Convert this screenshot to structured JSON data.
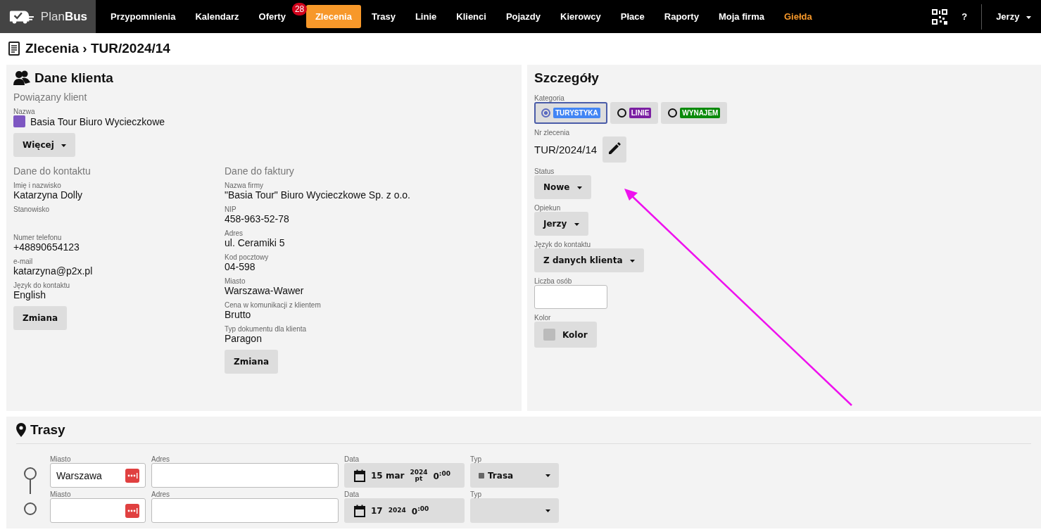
{
  "app": {
    "logo_light": "Plan",
    "logo_bold": "Bus"
  },
  "nav": [
    {
      "label": "Przypomnienia",
      "selected": false,
      "highlighted": false
    },
    {
      "label": "Kalendarz",
      "selected": false,
      "highlighted": false
    },
    {
      "label": "Oferty",
      "selected": false,
      "highlighted": false,
      "badge": "28"
    },
    {
      "label": "Zlecenia",
      "selected": true,
      "highlighted": false
    },
    {
      "label": "Trasy",
      "selected": false,
      "highlighted": false
    },
    {
      "label": "Linie",
      "selected": false,
      "highlighted": false
    },
    {
      "label": "Klienci",
      "selected": false,
      "highlighted": false
    },
    {
      "label": "Pojazdy",
      "selected": false,
      "highlighted": false
    },
    {
      "label": "Kierowcy",
      "selected": false,
      "highlighted": false
    },
    {
      "label": "Płace",
      "selected": false,
      "highlighted": false
    },
    {
      "label": "Raporty",
      "selected": false,
      "highlighted": false
    },
    {
      "label": "Moja firma",
      "selected": false,
      "highlighted": false
    },
    {
      "label": "Giełda",
      "selected": false,
      "highlighted": true
    }
  ],
  "nav_right": {
    "help": "?",
    "user": "Jerzy"
  },
  "page_title": "Zlecenia › TUR/2024/14",
  "client": {
    "title": "Dane klienta",
    "linked_heading": "Powiązany klient",
    "name_label": "Nazwa",
    "name": {
      "value": "Basia Tour Biuro Wycieczkowe",
      "color": "#7e57c2"
    },
    "more_button": "Więcej",
    "contact": {
      "heading": "Dane do kontaktu",
      "fields": [
        {
          "label": "Imię i nazwisko",
          "value": "Katarzyna Dolly"
        },
        {
          "label": "Stanowisko"
        },
        {
          "label": "Numer telefonu",
          "value": "+48890654123"
        },
        {
          "label": "e-mail",
          "value": "katarzyna@p2x.pl"
        },
        {
          "label": "Język do kontaktu",
          "value": "English"
        }
      ],
      "button": "Zmiana"
    },
    "invoice": {
      "heading": "Dane do faktury",
      "fields": [
        {
          "label": "Nazwa firmy",
          "value": "\"Basia Tour\" Biuro Wycieczkowe Sp. z o.o."
        },
        {
          "label": "NIP",
          "value": "458-963-52-78"
        },
        {
          "label": "Adres",
          "value": "ul. Ceramiki 5"
        },
        {
          "label": "Kod pocztowy",
          "value": "04-598"
        },
        {
          "label": "Miasto",
          "value": "Warszawa-Wawer"
        },
        {
          "label": "Cena w komunikacji z klientem",
          "value": "Brutto"
        },
        {
          "label": "Typ dokumentu dla klienta",
          "value": "Paragon"
        }
      ],
      "button": "Zmiana"
    }
  },
  "details": {
    "title": "Szczegóły",
    "category_label": "Kategoria",
    "categories": [
      {
        "label": "TURYSTYKA",
        "color": "#4285f4",
        "selected": true
      },
      {
        "label": "LINIE",
        "color": "#7b1fa2",
        "selected": false
      },
      {
        "label": "WYNAJEM",
        "color": "#0a8a0a",
        "selected": false
      }
    ],
    "order_number_label": "Nr zlecenia",
    "order_number": "TUR/2024/14",
    "dropdowns": [
      {
        "label": "Status",
        "value": "Nowe"
      },
      {
        "label": "Opiekun",
        "value": "Jerzy"
      },
      {
        "label": "Język do kontaktu",
        "value": "Z danych klienta"
      }
    ],
    "people_label": "Liczba osób",
    "color_label": "Kolor",
    "color_button": "Kolor"
  },
  "routes": {
    "title": "Trasy",
    "stops": [
      {
        "city_label": "Miasto",
        "city": "Warszawa",
        "address_label": "Adres",
        "date_label": "Data",
        "day": "15 mar",
        "year": "2024",
        "weekday": "pt",
        "hour": "0",
        "minutes": ":00",
        "type_label": "Typ",
        "type": "Trasa"
      },
      {
        "city_label": "Miasto",
        "address_label": "Adres",
        "date_label": "Data",
        "day": "17",
        "year": "2024",
        "hour": "0",
        "minutes": ":00",
        "type_label": "Typ"
      }
    ]
  }
}
